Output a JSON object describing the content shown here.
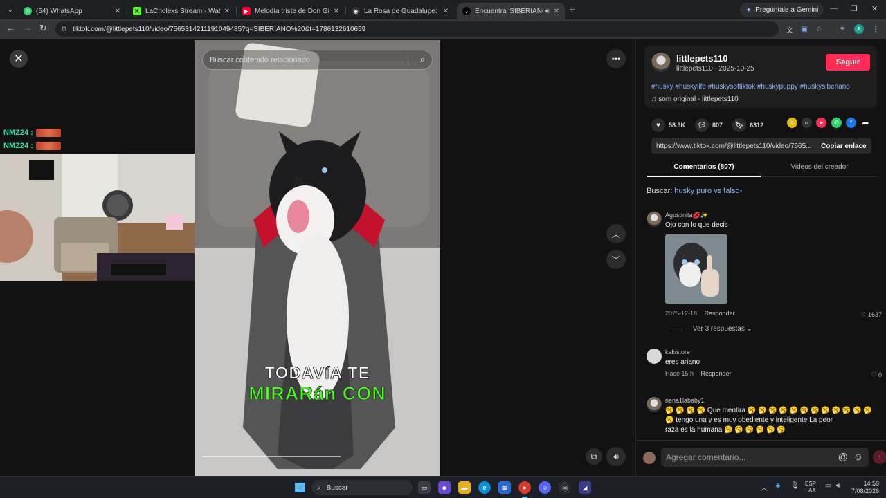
{
  "browser": {
    "tabs": [
      {
        "title": "(54) WhatsApp",
        "favicon": "whatsapp-icon",
        "color": "#25d366"
      },
      {
        "title": "LaCholexs Stream - Watch Live",
        "favicon": "kick-icon",
        "color": "#53fc18"
      },
      {
        "title": "Melodía triste de Don Gilberto",
        "favicon": "youtube-icon",
        "color": "#ff0033"
      },
      {
        "title": "La Rosa de Guadalupe: capítulo",
        "favicon": "site-icon",
        "color": "#333333"
      },
      {
        "title": "Encuentra 'SIBERIANO' en",
        "favicon": "tiktok-icon",
        "color": "#000000"
      }
    ],
    "gemini_label": "Pregúntale a Gemini",
    "url": "tiktok.com/@littlepets110/video/7565314211191049485?q=SIBERIANO%20&t=1786132610659",
    "profile_initial": "A"
  },
  "overlay": {
    "chat": [
      {
        "user": "NMZ24 :"
      },
      {
        "user": "NMZ24 :"
      }
    ]
  },
  "video": {
    "search_placeholder": "Buscar contenido relacionado",
    "caption_line1": "TODAVíA TE",
    "caption_line2": "MIRARán CON",
    "progress": 0.6
  },
  "author": {
    "username": "littlepets110",
    "subline": "littlepets110 · 2025-10-25",
    "follow_label": "Seguir",
    "hashtags": "#husky #huskylife #huskysoftiktok #huskypuppy #huskysiberiano",
    "sound": "som original - littlepets110"
  },
  "stats": {
    "likes": "58.3K",
    "comments": "807",
    "saves": "6312"
  },
  "share": {
    "link": "https://www.tiktok.com/@littlepets110/video/7565...",
    "copy_label": "Copiar enlace"
  },
  "panel_tabs": {
    "comments": "Comentarios (807)",
    "creator_videos": "Videos del creador"
  },
  "search_suggestion": {
    "label": "Buscar:",
    "query": "husky puro vs falso"
  },
  "comments": [
    {
      "name": "Agustinita💋✨",
      "text": "Ojo con lo que decis",
      "date": "2025-12-18",
      "reply": "Responder",
      "likes": "1637",
      "replies_label": "Ver 3 respuestas"
    },
    {
      "name": "kakistore",
      "text": "eres ariano",
      "date": "Hace 15 h",
      "reply": "Responder",
      "likes": "0"
    },
    {
      "name": "nena1lababy1",
      "text": "🥱 🥱 🥱 🥱 Que mentira 🥱 🥱 🥱 🥱 🥱 🥱 🥱 🥱 🥱 🥱 🥱 🥱",
      "text2": "🥱 tengo una y es muy obediente y inteligente La peor",
      "text3": "raza es la humana 🥱 🥱 🥱 🥱 🥱 🥱"
    }
  ],
  "comment_box": {
    "placeholder": "Agregar comentario..."
  },
  "taskbar": {
    "search_label": "Buscar",
    "lang_line1": "ESP",
    "lang_line2": "LAA",
    "time": "14:58",
    "date": "7/08/2026"
  }
}
